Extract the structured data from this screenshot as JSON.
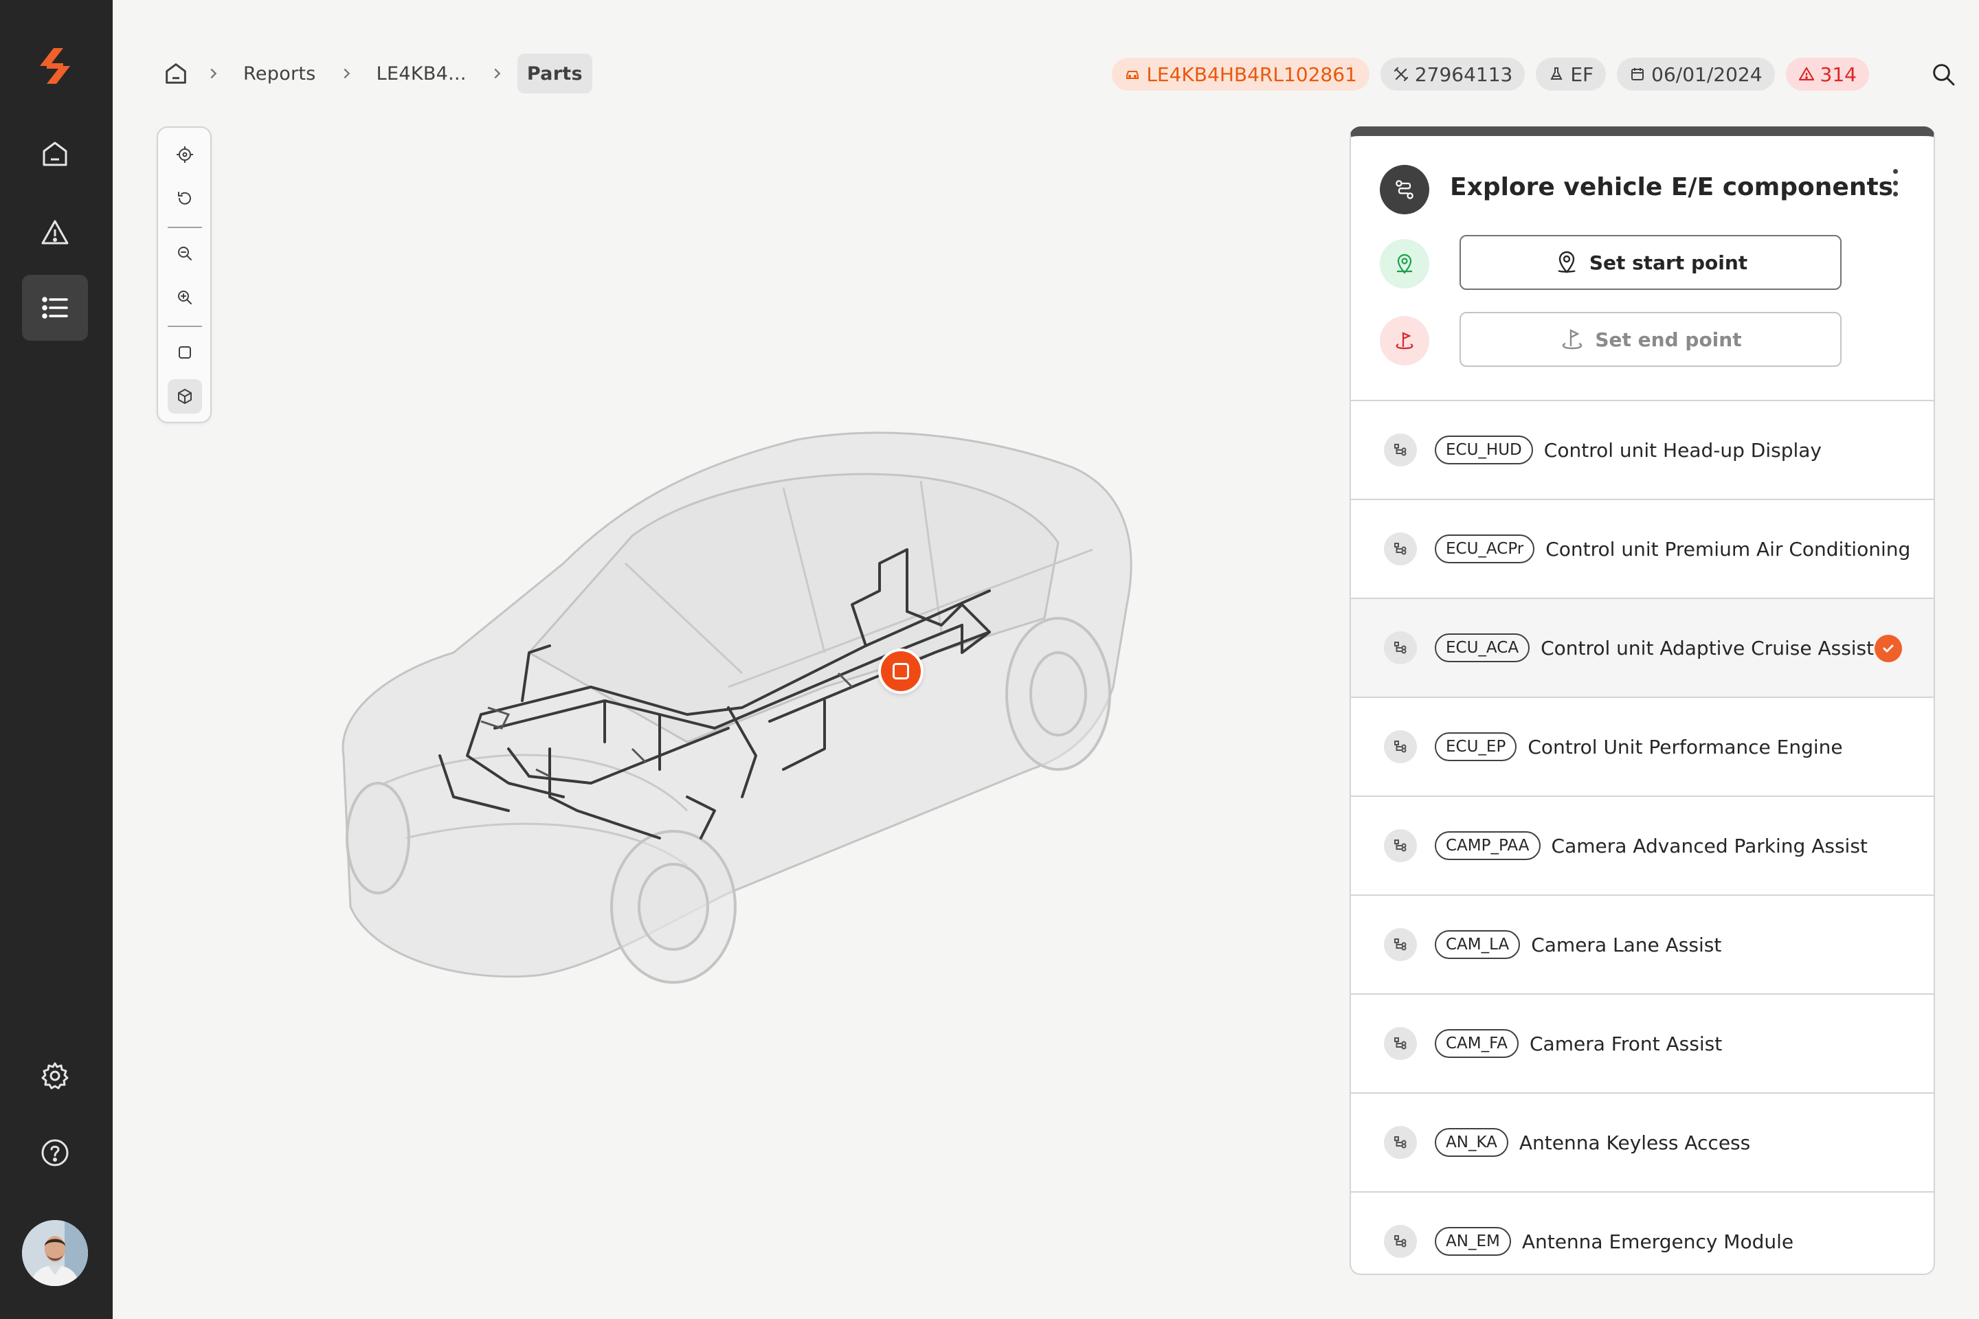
{
  "sidebar": {
    "items": [
      {
        "icon": "home-icon"
      },
      {
        "icon": "warning-icon"
      },
      {
        "icon": "list-icon",
        "active": true
      },
      {
        "icon": "gear-icon"
      },
      {
        "icon": "help-icon"
      }
    ]
  },
  "breadcrumb": {
    "items": [
      "Reports",
      "LE4KB4...",
      "Parts"
    ]
  },
  "header": {
    "vin": "LE4KB4HB4RL102861",
    "part_number": "27964113",
    "variant": "EF",
    "date": "06/01/2024",
    "alert_count": "314"
  },
  "panel": {
    "title": "Explore vehicle E/E components",
    "start_label": "Set start point",
    "end_label": "Set end point",
    "components": [
      {
        "code": "ECU_HUD",
        "name": "Control unit Head-up Display",
        "selected": false
      },
      {
        "code": "ECU_ACPr",
        "name": "Control unit Premium Air Conditioning",
        "selected": false
      },
      {
        "code": "ECU_ACA",
        "name": "Control unit Adaptive Cruise Assist",
        "selected": true
      },
      {
        "code": "ECU_EP",
        "name": "Control Unit Performance Engine",
        "selected": false
      },
      {
        "code": "CAMP_PAA",
        "name": "Camera Advanced Parking Assist",
        "selected": false
      },
      {
        "code": "CAM_LA",
        "name": "Camera Lane Assist",
        "selected": false
      },
      {
        "code": "CAM_FA",
        "name": "Camera Front Assist",
        "selected": false
      },
      {
        "code": "AN_KA",
        "name": "Antenna Keyless Access",
        "selected": false
      },
      {
        "code": "AN_EM",
        "name": "Antenna Emergency Module",
        "selected": false
      }
    ]
  },
  "colors": {
    "accent": "#f04a14",
    "sidebar_bg": "#262626",
    "page_bg": "#f5f5f4",
    "vin_chip_bg": "#fde3d7",
    "alert_chip_bg": "#fcdcdc"
  }
}
